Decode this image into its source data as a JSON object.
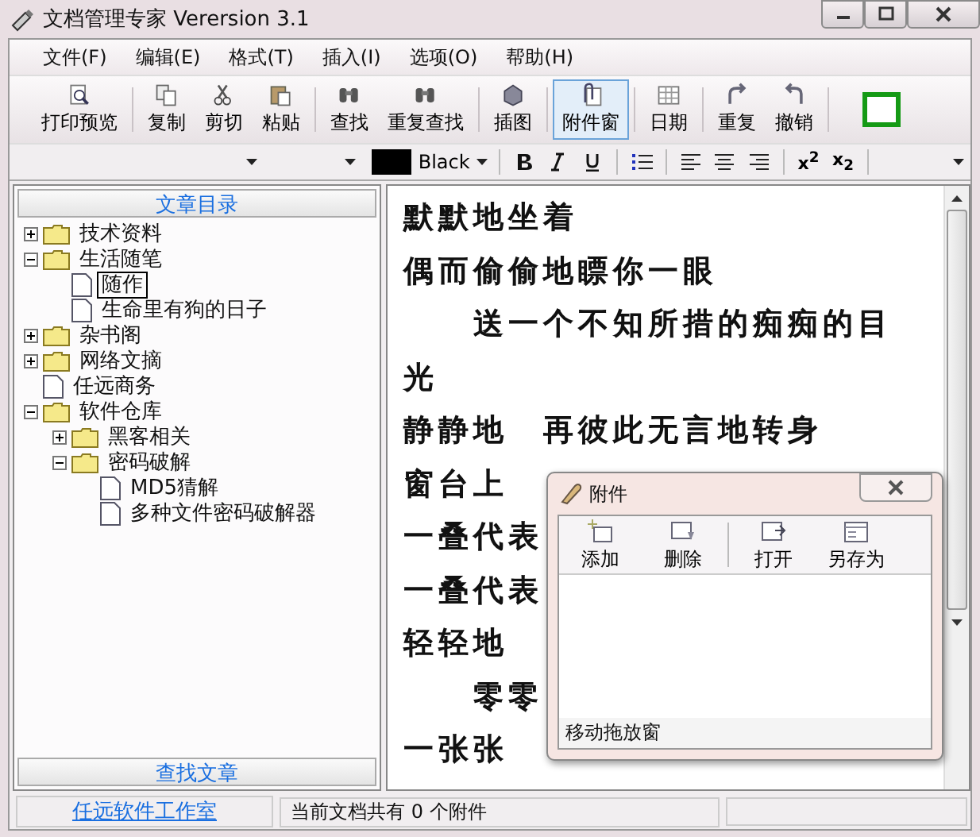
{
  "window": {
    "title": "文档管理专家 Verersion 3.1"
  },
  "menu": [
    "文件(F)",
    "编辑(E)",
    "格式(T)",
    "插入(I)",
    "选项(O)",
    "帮助(H)"
  ],
  "toolbar": {
    "groups": [
      [
        {
          "label": "打印预览",
          "pressed": false
        }
      ],
      [
        {
          "label": "复制",
          "pressed": false
        },
        {
          "label": "剪切",
          "pressed": false
        },
        {
          "label": "粘贴",
          "pressed": false
        }
      ],
      [
        {
          "label": "查找",
          "pressed": false
        },
        {
          "label": "重复查找",
          "pressed": false
        }
      ],
      [
        {
          "label": "插图",
          "pressed": false
        }
      ],
      [
        {
          "label": "附件窗",
          "pressed": true
        }
      ],
      [
        {
          "label": "日期",
          "pressed": false
        }
      ],
      [
        {
          "label": "重复",
          "pressed": false
        },
        {
          "label": "撤销",
          "pressed": false
        }
      ]
    ]
  },
  "format_bar": {
    "color_name": "Black",
    "superscript": "x$^{2}$",
    "subscript": "x$_{2}$"
  },
  "sidebar": {
    "header": "文章目录",
    "footer": "查找文章",
    "tree": [
      {
        "label": "技术资料",
        "kind": "folder",
        "expanded": false,
        "selected": false
      },
      {
        "label": "生活随笔",
        "kind": "folder",
        "expanded": true,
        "selected": false,
        "children": [
          {
            "label": "随作",
            "kind": "document",
            "selected": true
          },
          {
            "label": "生命里有狗的日子",
            "kind": "document",
            "selected": false
          }
        ]
      },
      {
        "label": "杂书阁",
        "kind": "folder",
        "expanded": false,
        "selected": false
      },
      {
        "label": "网络文摘",
        "kind": "folder",
        "expanded": false,
        "selected": false
      },
      {
        "label": "任远商务",
        "kind": "document",
        "selected": false
      },
      {
        "label": "软件仓库",
        "kind": "folder",
        "expanded": true,
        "selected": false,
        "children": [
          {
            "label": "黑客相关",
            "kind": "folder",
            "expanded": false,
            "selected": false
          },
          {
            "label": "密码破解",
            "kind": "folder",
            "expanded": true,
            "selected": false,
            "children": [
              {
                "label": "MD5猜解",
                "kind": "document",
                "selected": false
              },
              {
                "label": "多种文件密码破解器",
                "kind": "document",
                "selected": false
              }
            ]
          }
        ]
      }
    ]
  },
  "editor": {
    "lines": [
      "默默地坐着",
      "偶而偷偷地瞟你一眼",
      "　　送一个不知所措的痴痴的目",
      "光",
      "静静地　再彼此无言地转身",
      "窗台上",
      "一叠代表",
      "一叠代表",
      "轻轻地",
      "　　零零",
      "一张张"
    ]
  },
  "attachment_window": {
    "title": "附件",
    "buttons": [
      [
        {
          "label": "添加"
        },
        {
          "label": "删除"
        }
      ],
      [
        {
          "label": "打开"
        },
        {
          "label": "另存为"
        }
      ]
    ],
    "footer": "移动拖放窗"
  },
  "status_bar": {
    "link": "任远软件工作室",
    "message": "当前文档共有 0 个附件"
  }
}
